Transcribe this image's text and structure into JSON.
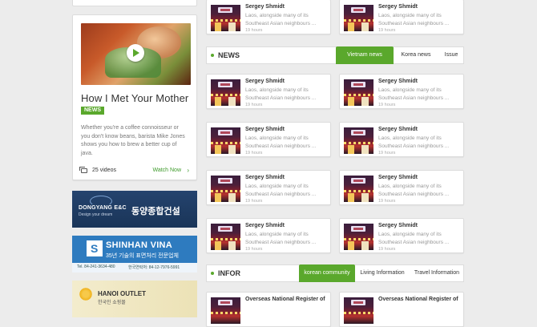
{
  "video": {
    "title": "How I Met Your Mother",
    "badge": "NEWS",
    "description": "Whether you're a coffee connoisseur or you don't know beans, barista Mike Jones shows you how to brew a better cup of java.",
    "count": "25 videos",
    "watch_label": "Watch Now",
    "watch_arrow": "›"
  },
  "ads": {
    "dongyang": {
      "brand": "DONGYANG E&C",
      "slogan": "Design your dream",
      "korean": "동양종합건설"
    },
    "shinhan": {
      "brand": "SHINHAN VINA",
      "korean": "35년 기술의 표면처리 전문업체",
      "tel": "Tel. 84-241-3634-480",
      "tel2": "한국연락처: 84-12-7976-5991"
    },
    "hanoi": {
      "brand": "HANOI OUTLET",
      "korean": "한국인 쇼핑몰"
    }
  },
  "news_section": {
    "label": "NEWS",
    "tabs": [
      "Vietnam news",
      "Korea news",
      "Issue"
    ],
    "active_tab": 0
  },
  "infor_section": {
    "label": "INFOR",
    "tabs": [
      "korean community",
      "Living Information",
      "Travel Information"
    ],
    "active_tab": 0
  },
  "news_items": [
    {
      "name": "Sergey Shmidt",
      "desc": "Laos, alongside many of its Southeast Asian neighbours ...",
      "time": "19 hours"
    },
    {
      "name": "Sergey Shmidt",
      "desc": "Laos, alongside many of its Southeast Asian neighbours ...",
      "time": "19 hours"
    },
    {
      "name": "Sergey Shmidt",
      "desc": "Laos, alongside many of its Southeast Asian neighbours ...",
      "time": "19 hours"
    },
    {
      "name": "Sergey Shmidt",
      "desc": "Laos, alongside many of its Southeast Asian neighbours ...",
      "time": "19 hours"
    },
    {
      "name": "Sergey Shmidt",
      "desc": "Laos, alongside many of its Southeast Asian neighbours ...",
      "time": "19 hours"
    },
    {
      "name": "Sergey Shmidt",
      "desc": "Laos, alongside many of its Southeast Asian neighbours ...",
      "time": "19 hours"
    },
    {
      "name": "Sergey Shmidt",
      "desc": "Laos, alongside many of its Southeast Asian neighbours ...",
      "time": "19 hours"
    },
    {
      "name": "Sergey Shmidt",
      "desc": "Laos, alongside many of its Southeast Asian neighbours ...",
      "time": "19 hours"
    },
    {
      "name": "Sergey Shmidt",
      "desc": "Laos, alongside many of its Southeast Asian neighbours ...",
      "time": "19 hours"
    },
    {
      "name": "Sergey Shmidt",
      "desc": "Laos, alongside many of its Southeast Asian neighbours ...",
      "time": "19 hours"
    }
  ],
  "infor_items": [
    {
      "name": "Overseas National Register of"
    },
    {
      "name": "Overseas National Register of"
    }
  ]
}
